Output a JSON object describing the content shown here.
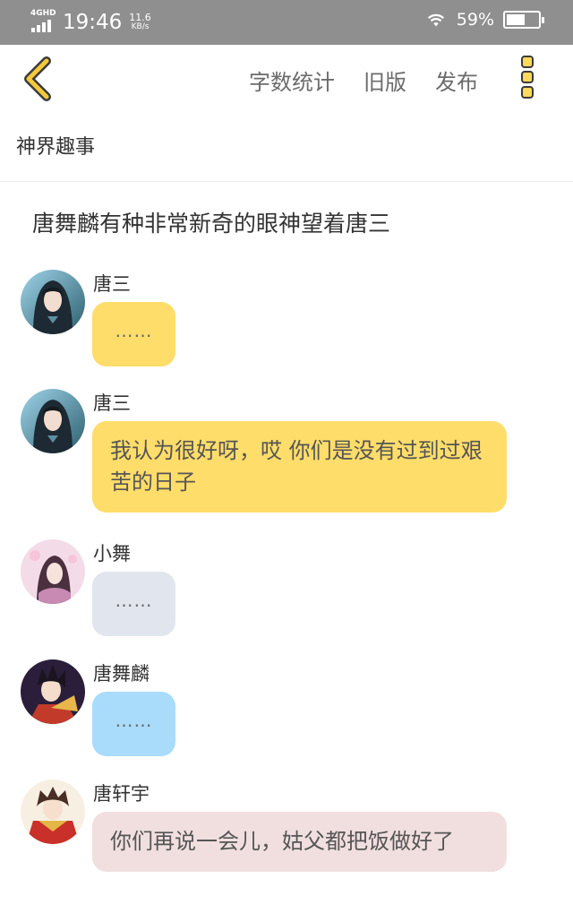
{
  "status_bar": {
    "network": "4GHD",
    "time": "19:46",
    "speed_value": "11.6",
    "speed_unit": "KB/s",
    "battery_percent": "59%",
    "battery_level": 0.59
  },
  "toolbar": {
    "word_count_label": "字数统计",
    "old_version_label": "旧版",
    "publish_label": "发布"
  },
  "story": {
    "title": "神界趣事",
    "narration": "唐舞麟有种非常新奇的眼神望着唐三"
  },
  "messages": [
    {
      "sender": "唐三",
      "text": "……",
      "bubble_color": "#ffdd6a"
    },
    {
      "sender": "唐三",
      "text": "我认为很好呀，哎 你们是没有过到过艰苦的日子",
      "bubble_color": "#ffdd6a"
    },
    {
      "sender": "小舞",
      "text": "……",
      "bubble_color": "#e1e6ee"
    },
    {
      "sender": "唐舞麟",
      "text": "……",
      "bubble_color": "#a9dbfb"
    },
    {
      "sender": "唐轩宇",
      "text": "你们再说一会儿，姑父都把饭做好了",
      "bubble_color": "#f1dfe0"
    }
  ],
  "colors": {
    "accent": "#f3c93c",
    "status_bar": "#8f8f8f"
  }
}
